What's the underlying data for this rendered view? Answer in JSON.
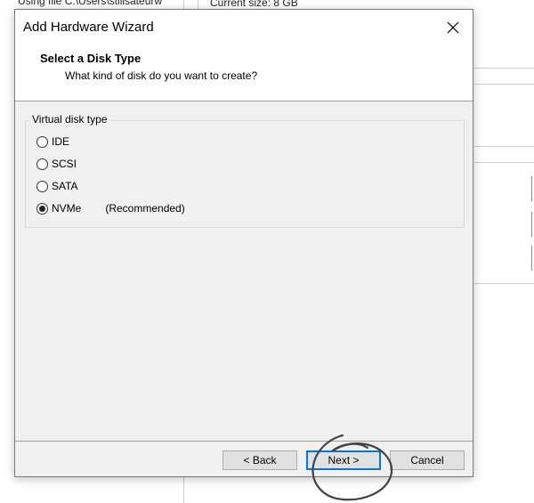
{
  "background": {
    "left_text": "Using file C:\\Users\\stilisateurw",
    "current_size": "Current size: 8 GB"
  },
  "dialog": {
    "title": "Add Hardware Wizard",
    "header_title": "Select a Disk Type",
    "header_subtitle": "What kind of disk do you want to create?",
    "group_label": "Virtual disk type",
    "options": [
      {
        "label": "IDE",
        "checked": false,
        "note": ""
      },
      {
        "label": "SCSI",
        "checked": false,
        "note": ""
      },
      {
        "label": "SATA",
        "checked": false,
        "note": ""
      },
      {
        "label": "NVMe",
        "checked": true,
        "note": "(Recommended)"
      }
    ],
    "buttons": {
      "back": "< Back",
      "next": "Next >",
      "cancel": "Cancel"
    }
  },
  "icons": {
    "close": "close-icon"
  },
  "colors": {
    "dialog_bg": "#f0f0f0",
    "default_button_border": "#0078d7",
    "annotation": "#444444"
  }
}
